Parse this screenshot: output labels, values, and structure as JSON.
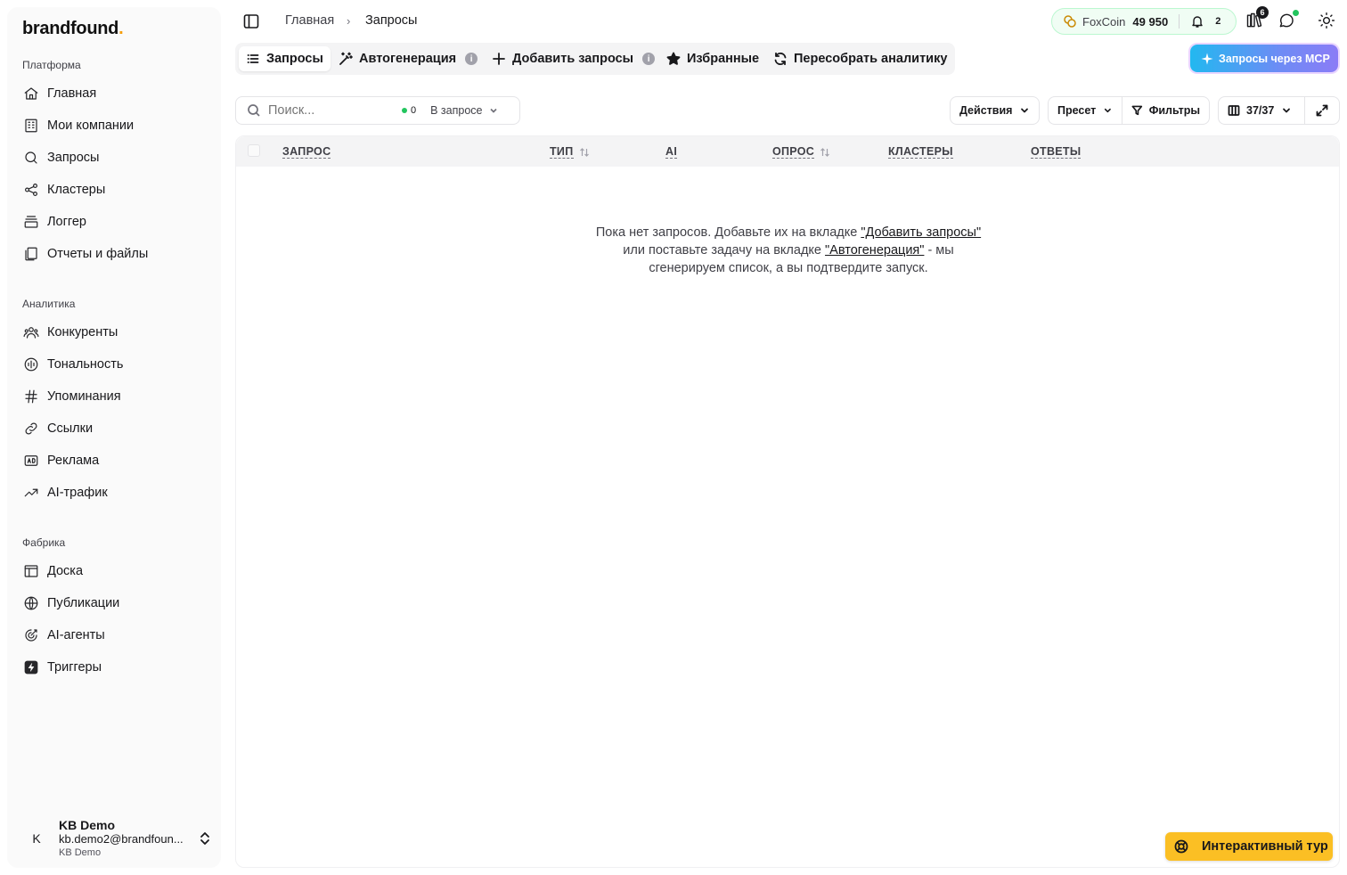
{
  "brand": {
    "name": "brandfound",
    "dot": "."
  },
  "sidebar": {
    "sections": [
      {
        "title": "Платформа",
        "items": [
          {
            "label": "Главная",
            "icon": "home-icon"
          },
          {
            "label": "Мои компании",
            "icon": "building-icon"
          },
          {
            "label": "Запросы",
            "icon": "search-icon"
          },
          {
            "label": "Кластеры",
            "icon": "share-nodes-icon"
          },
          {
            "label": "Логгер",
            "icon": "stack-icon"
          },
          {
            "label": "Отчеты и файлы",
            "icon": "files-icon"
          }
        ]
      },
      {
        "title": "Аналитика",
        "items": [
          {
            "label": "Конкуренты",
            "icon": "users-icon"
          },
          {
            "label": "Тональность",
            "icon": "tone-icon"
          },
          {
            "label": "Упоминания",
            "icon": "hash-icon"
          },
          {
            "label": "Ссылки",
            "icon": "link-icon"
          },
          {
            "label": "Реклама",
            "icon": "ad-icon"
          },
          {
            "label": "AI-трафик",
            "icon": "trend-up-icon"
          }
        ]
      },
      {
        "title": "Фабрика",
        "items": [
          {
            "label": "Доска",
            "icon": "board-icon"
          },
          {
            "label": "Публикации",
            "icon": "globe-icon"
          },
          {
            "label": "AI-агенты",
            "icon": "target-icon"
          },
          {
            "label": "Триггеры",
            "icon": "bolt-icon"
          }
        ]
      }
    ],
    "user": {
      "initial": "K",
      "name": "KB Demo",
      "email": "kb.demo2@brandfoun...",
      "org": "KB Demo"
    }
  },
  "header": {
    "breadcrumb": [
      "Главная",
      "Запросы"
    ],
    "foxcoin": {
      "label": "FoxCoin",
      "value": "49 950",
      "notifications": "2"
    },
    "books_badge": "6"
  },
  "tabs": [
    {
      "label": "Запросы",
      "active": true
    },
    {
      "label": "Автогенерация",
      "info": true
    },
    {
      "label": "Добавить запросы",
      "info": true
    },
    {
      "label": "Избранные"
    },
    {
      "label": "Пересобрать аналитику"
    }
  ],
  "mcp_button": "Запросы через MCP",
  "toolbar": {
    "search_placeholder": "Поиск...",
    "search_count": "0",
    "scope": "В запросе",
    "actions": "Действия",
    "preset": "Пресет",
    "filters": "Фильтры",
    "columns": "37/37"
  },
  "table": {
    "columns": [
      "ЗАПРОС",
      "ТИП",
      "AI",
      "ОПРОС",
      "КЛАСТЕРЫ",
      "ОТВЕТЫ"
    ],
    "empty": {
      "text1": "Пока нет запросов. Добавьте их на вкладке ",
      "link1": "\"Добавить запросы\"",
      "text2": " или поставьте задачу на вкладке ",
      "link2": "\"Автогенерация\"",
      "text3": " - мы сгенерируем список, а вы подтвердите запуск."
    }
  },
  "tour_button": "Интерактивный тур",
  "colors": {
    "accent_green": "#22c55e",
    "tour_yellow": "#fbbf24",
    "brand_dot": "#f59e0b"
  }
}
